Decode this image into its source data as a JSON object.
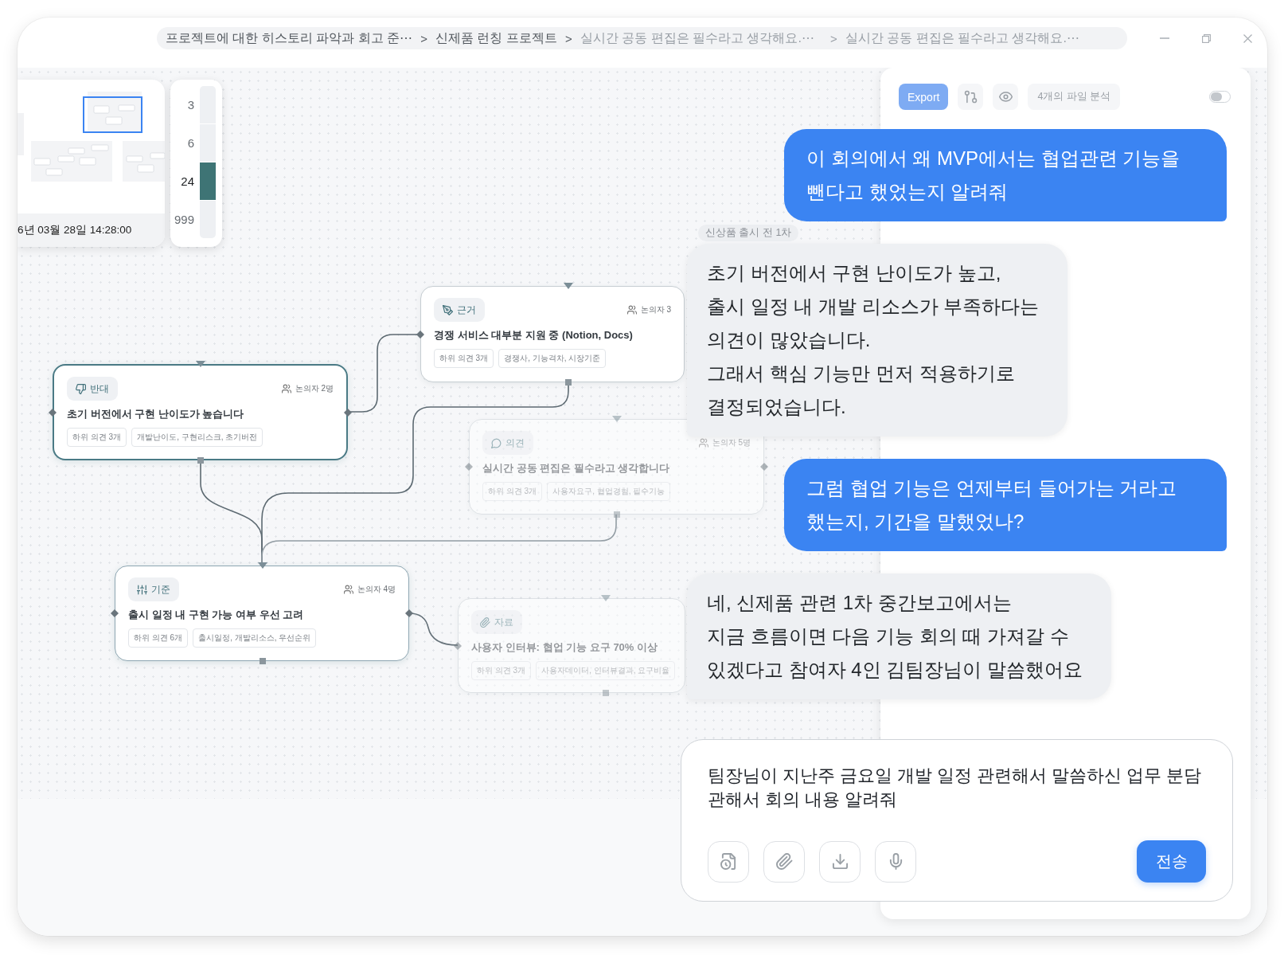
{
  "breadcrumb": [
    {
      "kind": "crumb",
      "label": "프로젝트에 대한 히스토리 파악과 회고 준⋯",
      "muted": false
    },
    {
      "kind": "separator",
      "label": ">",
      "muted": false
    },
    {
      "kind": "crumb",
      "label": "신제품 런칭 프로젝트",
      "muted": false
    },
    {
      "kind": "separator",
      "label": ">",
      "muted": false
    },
    {
      "kind": "crumb",
      "label": "실시간 공동 편집은 필수라고 생각해요.⋯",
      "muted": true
    },
    {
      "kind": "separator",
      "label": ">",
      "muted": true
    },
    {
      "kind": "crumb",
      "label": "실시간 공동 편집은 필수라고 생각해요.⋯",
      "muted": true
    }
  ],
  "minimap": {
    "timestamp": "6년 03월 28일 14:28:00"
  },
  "zoom_levels": [
    {
      "label": "3",
      "selected": false
    },
    {
      "label": "6",
      "selected": false
    },
    {
      "label": "24",
      "selected": true
    },
    {
      "label": "999",
      "selected": false
    }
  ],
  "canvas": {
    "group_label": "신상품 출시 전 1차",
    "nodes": [
      {
        "kind": "evidence",
        "tag": "근거",
        "participants": "논의자 3",
        "title": "경쟁 서비스 대부분 지원 중 (Notion, Docs)",
        "chips": [
          "하위 의견 3개",
          "경쟁사, 기능격차, 시장기준"
        ],
        "selected": false,
        "linked": false,
        "dimmed": false
      },
      {
        "kind": "against",
        "tag": "반대",
        "participants": "논의자 2명",
        "title": "초기 버전에서 구현 난이도가 높습니다",
        "chips": [
          "하위 의견 3개",
          "개발난이도, 구현리스크, 초기버전"
        ],
        "selected": true,
        "linked": true,
        "dimmed": false
      },
      {
        "kind": "opinion",
        "tag": "의견",
        "participants": "논의자 5명",
        "title": "실시간 공동 편집은 필수라고 생각합니다",
        "chips": [
          "하위 의견 3개",
          "사용자요구, 협업경험, 필수기능"
        ],
        "selected": false,
        "linked": false,
        "dimmed": true
      },
      {
        "kind": "criterion",
        "tag": "기준",
        "participants": "논의자 4명",
        "title": "출시 일정 내 구현 가능 여부 우선 고려",
        "chips": [
          "하위 의견 6개",
          "출시일정, 개발리소스, 우선순위"
        ],
        "selected": false,
        "linked": true,
        "dimmed": false
      },
      {
        "kind": "material",
        "tag": "자료",
        "title": "사용자 인터뷰: 협업 기능 요구 70% 이상",
        "chips": [
          "하위 의견 3개",
          "사용자데이터, 인터뷰결과, 요구비율"
        ],
        "selected": false,
        "linked": false,
        "dimmed": true
      }
    ]
  },
  "chat": {
    "toolbar": {
      "export_label": "Export",
      "files_label": "4개의 파일 분석",
      "toggle": {
        "on": false
      }
    },
    "messages": [
      {
        "kind": "user",
        "text": "이 회의에서 왜 MVP에서는 협업관련 기능을\n뺀다고 했었는지 알려줘"
      },
      {
        "kind": "assistant",
        "text": "초기 버전에서 구현 난이도가 높고,\n출시 일정 내 개발 리소스가 부족하다는\n의견이 많았습니다.\n그래서 핵심 기능만 먼저 적용하기로\n결정되었습니다."
      },
      {
        "kind": "user",
        "text": "그럼 협업 기능은 언제부터 들어가는 거라고\n했는지, 기간을 말했었나?"
      },
      {
        "kind": "assistant",
        "text": "네, 신제품 관련 1차 중간보고에서는\n지금 흐름이면 다음 기능 회의 때 가져갈 수\n있겠다고 참여자 4인 김팀장님이 말씀했어요"
      }
    ],
    "composer": {
      "value": "팀장님이 지난주 금요일 개발 일정 관련해서 말씀하신 업무 분담 관해서 회의 내용 알려줘",
      "send_label": "전송"
    }
  }
}
